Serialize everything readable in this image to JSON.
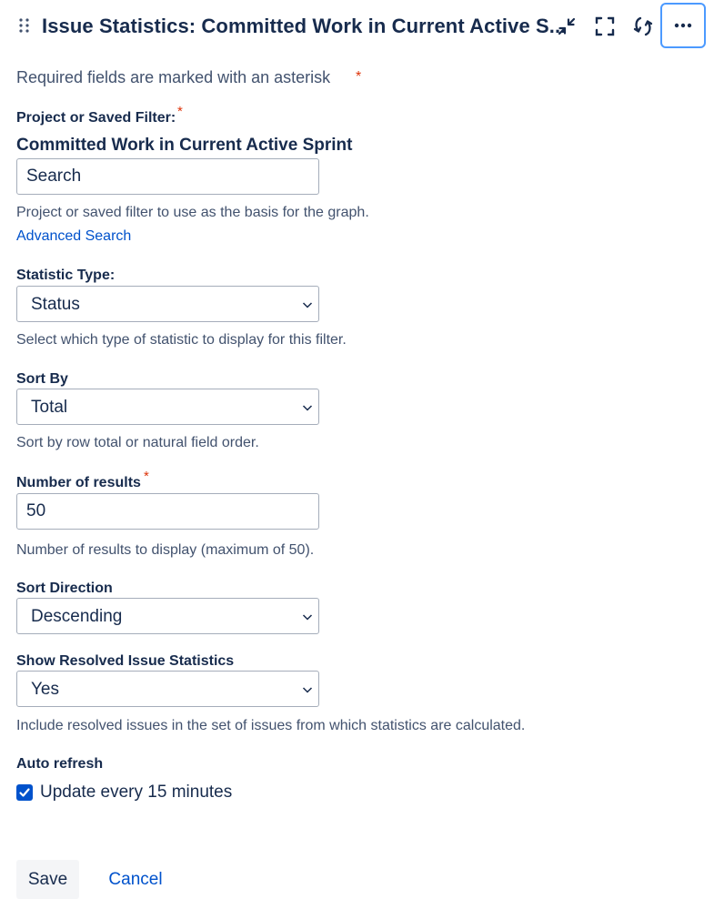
{
  "header": {
    "title": "Issue Statistics: Committed Work in Current Active S...",
    "icons": [
      "drag-handle-icon",
      "minimize-icon",
      "maximize-icon",
      "refresh-icon",
      "more-icon"
    ]
  },
  "form": {
    "required_note": "Required fields are marked with an asterisk",
    "asterisk": "*",
    "filter": {
      "label": "Project or Saved Filter:",
      "selected_name": "Committed Work in Current Active Sprint",
      "search_placeholder": "Search",
      "help": "Project or saved filter to use as the basis for the graph.",
      "advanced_link": "Advanced Search"
    },
    "statistic_type": {
      "label": "Statistic Type:",
      "value": "Status",
      "help": "Select which type of statistic to display for this filter."
    },
    "sort_by": {
      "label": "Sort By",
      "value": "Total",
      "help": "Sort by row total or natural field order."
    },
    "num_results": {
      "label": "Number of results",
      "value": "50",
      "help": "Number of results to display (maximum of 50)."
    },
    "sort_direction": {
      "label": "Sort Direction",
      "value": "Descending"
    },
    "show_resolved": {
      "label": "Show Resolved Issue Statistics",
      "value": "Yes",
      "help": "Include resolved issues in the set of issues from which statistics are calculated."
    },
    "auto_refresh": {
      "label": "Auto refresh",
      "checkbox_label": "Update every 15 minutes",
      "checked": true
    }
  },
  "actions": {
    "save_label": "Save",
    "cancel_label": "Cancel"
  },
  "colors": {
    "text": "#172b4d",
    "subtle_text": "#42526e",
    "link": "#0052cc",
    "required": "#de350b",
    "focus": "#4c9aff"
  }
}
